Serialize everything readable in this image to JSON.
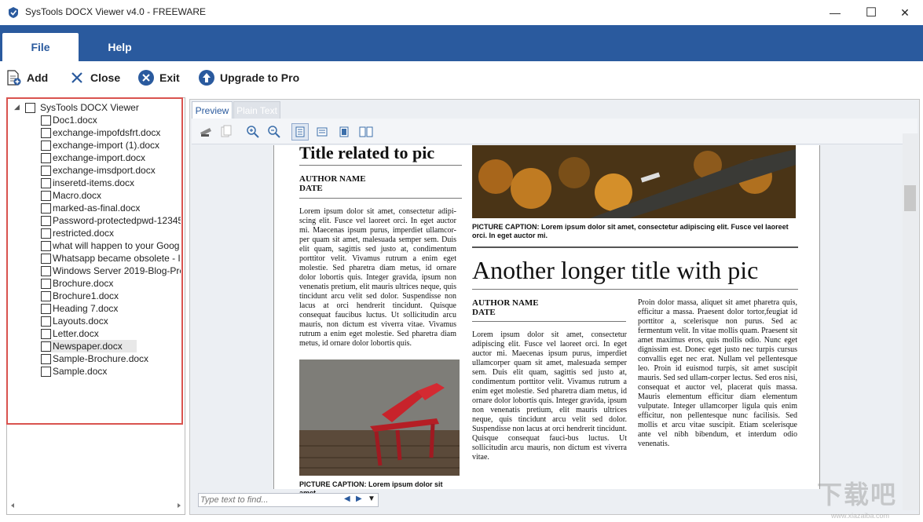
{
  "window": {
    "title": "SysTools DOCX Viewer v4.0 - FREEWARE",
    "minimize": "—",
    "maximize": "☐",
    "close": "✕"
  },
  "ribbon": {
    "tabs": [
      {
        "label": "File",
        "active": true
      },
      {
        "label": "Help",
        "active": false
      }
    ]
  },
  "toolbar": {
    "add_label": "Add",
    "close_label": "Close",
    "exit_label": "Exit",
    "upgrade_label": "Upgrade to Pro"
  },
  "tree": {
    "root": "SysTools DOCX Viewer",
    "files": [
      "Doc1.docx",
      "exchange-impofdsfrt.docx",
      "exchange-import (1).docx",
      "exchange-import.docx",
      "exchange-imsdport.docx",
      "inseretd-items.docx",
      "Macro.docx",
      "marked-as-final.docx",
      "Password-protectedpwd-12345",
      "restricted.docx",
      "what will happen to your Goog",
      "Whatsapp became obsolete - I",
      "Windows Server 2019-Blog-Pre",
      "Brochure.docx",
      "Brochure1.docx",
      "Heading 7.docx",
      "Layouts.docx",
      "Letter.docx",
      "Newspaper.docx",
      "Sample-Brochure.docx",
      "Sample.docx"
    ],
    "selected_index": 18
  },
  "viewer": {
    "tabs": [
      "Preview",
      "Plain Text"
    ],
    "find_placeholder": "Type text to find..."
  },
  "document": {
    "title1": "Title related to pic",
    "author1": "AUTHOR NAME",
    "date1": "DATE",
    "body1": "Lorem ipsum dolor sit amet, consectetur adipi-scing elit. Fusce vel laoreet orci. In eget auctor mi. Maecenas ipsum purus, imperdiet ullamcor-per quam sit amet, malesuada semper sem. Duis elit quam, sagittis sed justo at, condimentum porttitor velit. Vivamus rutrum a enim eget molestie. Sed pharetra diam metus, id ornare dolor lobortis quis. Integer gravida, ipsum non venenatis pretium, elit mauris ultrices neque, quis tincidunt arcu velit sed dolor. Suspendisse non lacus at orci hendrerit tincidunt. Quisque consequat faucibus luctus. Ut sollicitudin arcu mauris, non dictum est viverra vitae. Vivamus rutrum a enim eget molestie. Sed pharetra diam metus, id ornare dolor lobortis quis.",
    "caption_top": "PICTURE CAPTION: Lorem ipsum dolor sit amet, consectetur adipiscing elit. Fusce vel laoreet orci. In eget auctor mi.",
    "caption_bottom": "PICTURE CAPTION: Lorem ipsum dolor sit amet,",
    "title2": "Another longer title with pic",
    "author2": "AUTHOR NAME",
    "date2": "DATE",
    "body2": "Lorem ipsum dolor sit amet, consectetur adipiscing elit. Fusce vel laoreet orci. In eget auctor mi. Maecenas ipsum purus, imperdiet ullamcorper quam sit amet, malesuada semper sem. Duis elit quam, sagittis sed justo at, condimentum porttitor velit. Vivamus rutrum a enim eget molestie. Sed pharetra diam metus, id ornare dolor lobortis quis. Integer gravida, ipsum non venenatis pretium, elit mauris ultrices neque, quis tincidunt arcu velit sed dolor. Suspendisse non lacus at orci hendrerit tincidunt. Quisque consequat fauci-bus luctus. Ut sollicitudin arcu mauris, non dictum est viverra vitae.",
    "body3": "Proin dolor massa, aliquet sit amet pharetra quis, efficitur a massa. Praesent dolor tortor,feugiat id porttitor a, scelerisque non purus. Sed ac fermentum velit. In vitae mollis quam. Praesent sit amet maximus eros, quis mollis odio. Nunc eget dignissim est. Donec eget justo nec turpis cursus convallis eget nec erat. Nullam vel pellentesque leo. Proin id euismod turpis, sit amet suscipit mauris. Sed sed ullam-corper lectus. Sed eros nisi, consequat et auctor vel, placerat quis massa. Mauris elementum efficitur diam elementum vulputate. Integer ullamcorper ligula quis enim efficitur, non pellentesque nunc facilisis. Sed mollis et arcu vitae suscipit. Etiam scelerisque ante vel nibh bibendum, et interdum odio venenatis."
  },
  "watermark": {
    "text": "下载吧",
    "url": "www.xiazaiba.com"
  },
  "colors": {
    "ribbon": "#2a5a9e",
    "highlight_border": "#d9534f"
  }
}
